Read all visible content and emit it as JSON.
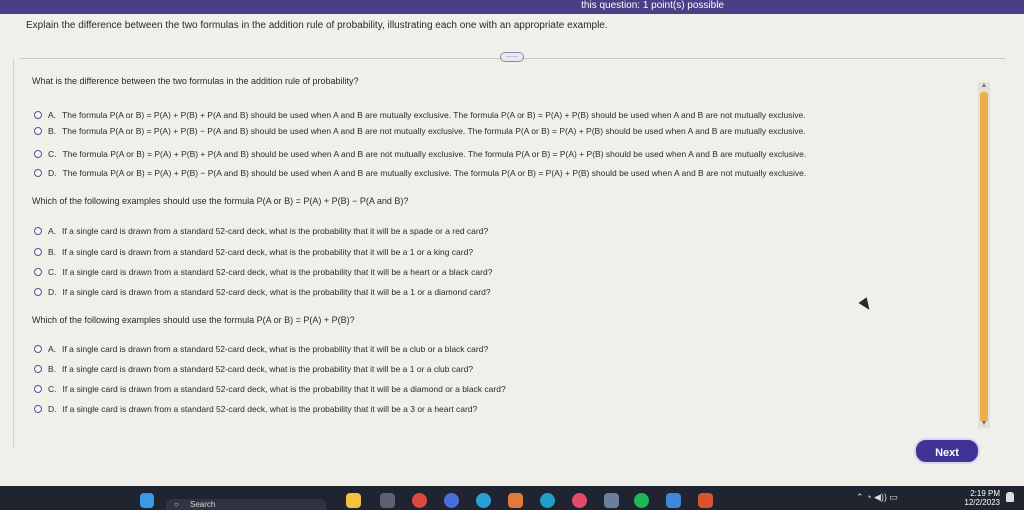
{
  "topbar": {
    "text": "this question: 1 point(s) possible"
  },
  "instructions": "Explain the difference between the two formulas in the addition rule of probability, illustrating each one with an appropriate example.",
  "more_handle": "····",
  "questions": [
    {
      "prompt": "What is the difference between the two formulas in the addition rule of probability?",
      "options": [
        {
          "letter": "A.",
          "text": "The formula P(A or B) = P(A) + P(B) + P(A and B) should be used when A and B are mutually exclusive. The formula P(A or B) = P(A) + P(B) should be used when A and B are not mutually exclusive."
        },
        {
          "letter": "B.",
          "text": "The formula P(A or B) = P(A) + P(B) − P(A and B) should be used when A and B are not mutually exclusive. The formula P(A or B) = P(A) + P(B) should be used when A and B are mutually exclusive."
        },
        {
          "letter": "C.",
          "text": "The formula P(A or B) = P(A) + P(B) + P(A and B) should be used when A and B are not mutually exclusive. The formula P(A or B) = P(A) + P(B) should be used when A and B are mutually exclusive."
        },
        {
          "letter": "D.",
          "text": "The formula P(A or B) = P(A) + P(B) − P(A and B) should be used when A and B are mutually exclusive. The formula P(A or B) = P(A) + P(B) should be used when A and B are not mutually exclusive."
        }
      ]
    },
    {
      "prompt": "Which of the following examples should use the formula P(A or B) = P(A) + P(B) − P(A and B)?",
      "options": [
        {
          "letter": "A.",
          "text": "If a single card is drawn from a standard 52-card deck, what is the probability that it will be a spade or a red card?"
        },
        {
          "letter": "B.",
          "text": "If a single card is drawn from a standard 52-card deck, what is the probability that it will be a 1 or a king card?"
        },
        {
          "letter": "C.",
          "text": "If a single card is drawn from a standard 52-card deck, what is the probability that it will be a heart or a black card?"
        },
        {
          "letter": "D.",
          "text": "If a single card is drawn from a standard 52-card deck, what is the probability that it will be a 1 or a diamond card?"
        }
      ]
    },
    {
      "prompt": "Which of the following examples should use the formula P(A or B) = P(A) + P(B)?",
      "options": [
        {
          "letter": "A.",
          "text": "If a single card is drawn from a standard 52-card deck, what is the probability that it will be a club or a black card?"
        },
        {
          "letter": "B.",
          "text": "If a single card is drawn from a standard 52-card deck, what is the probability that it will be a 1 or a club card?"
        },
        {
          "letter": "C.",
          "text": "If a single card is drawn from a standard 52-card deck, what is the probability that it will be a diamond or a black card?"
        },
        {
          "letter": "D.",
          "text": "If a single card is drawn from a standard 52-card deck, what is the probability that it will be a 3 or a heart card?"
        }
      ]
    }
  ],
  "next_label": "Next",
  "taskbar": {
    "search_label": "Search",
    "time": "2:19 PM",
    "date": "12/2/2023",
    "tray_symbols": "⌃ ◔ ◀)) ▭"
  },
  "colors": {
    "accent": "#3f3396",
    "scroll_thumb": "#eab04d",
    "topbar": "#4b3d86",
    "taskbar": "#1f2430"
  },
  "taskbar_icons": [
    "windows-icon",
    "search-icon",
    "file-explorer-icon",
    "camera-icon",
    "chrome-icon",
    "edge-icon",
    "photos-icon",
    "edge-alt-icon",
    "zoom-icon",
    "calculator-icon",
    "spotify-icon",
    "store-icon",
    "powerpoint-icon"
  ]
}
